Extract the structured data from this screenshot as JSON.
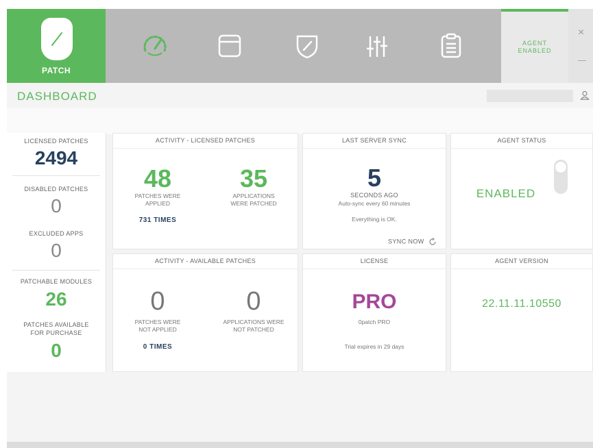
{
  "app": {
    "logo_label": "PATCH"
  },
  "nav": {
    "items": [
      {
        "name": "dashboard-gauge-icon",
        "active": true
      },
      {
        "name": "window-icon",
        "active": false
      },
      {
        "name": "shield-icon",
        "active": false
      },
      {
        "name": "sliders-icon",
        "active": false
      },
      {
        "name": "clipboard-icon",
        "active": false
      }
    ]
  },
  "agent_badge": {
    "line1": "AGENT",
    "line2": "ENABLED"
  },
  "window_controls": {
    "close": "×"
  },
  "header": {
    "title": "DASHBOARD"
  },
  "left": {
    "licensed_label": "LICENSED PATCHES",
    "licensed_value": "2494",
    "disabled_label": "DISABLED PATCHES",
    "disabled_value": "0",
    "excluded_label": "EXCLUDED APPS",
    "excluded_value": "0",
    "modules_label": "PATCHABLE MODULES",
    "modules_value": "26",
    "purchase_label_1": "PATCHES AVAILABLE",
    "purchase_label_2": "FOR PURCHASE",
    "purchase_value": "0"
  },
  "activity_licensed": {
    "title": "ACTIVITY - LICENSED PATCHES",
    "applied_value": "48",
    "applied_label_1": "PATCHES WERE",
    "applied_label_2": "APPLIED",
    "apps_value": "35",
    "apps_label_1": "APPLICATIONS",
    "apps_label_2": "WERE PATCHED",
    "times": "731 TIMES"
  },
  "server_sync": {
    "title": "LAST SERVER SYNC",
    "value": "5",
    "unit": "SECONDS AGO",
    "auto": "Auto-sync every 60 minutes",
    "status": "Everything is OK.",
    "sync_now": "SYNC NOW"
  },
  "agent_status": {
    "title": "AGENT STATUS",
    "value": "ENABLED"
  },
  "activity_available": {
    "title": "ACTIVITY - AVAILABLE PATCHES",
    "not_applied_value": "0",
    "not_applied_label_1": "PATCHES WERE",
    "not_applied_label_2": "NOT APPLIED",
    "not_patched_value": "0",
    "not_patched_label_1": "APPLICATIONS WERE",
    "not_patched_label_2": "NOT PATCHED",
    "times": "0 TIMES"
  },
  "license": {
    "title": "LICENSE",
    "value": "PRO",
    "product": "0patch PRO",
    "trial": "Trial expires in 29 days"
  },
  "agent_version": {
    "title": "AGENT VERSION",
    "value": "22.11.11.10550"
  },
  "colors": {
    "brand_green": "#5cb85c",
    "navy": "#27405e",
    "pro_purple": "#a4479a"
  }
}
